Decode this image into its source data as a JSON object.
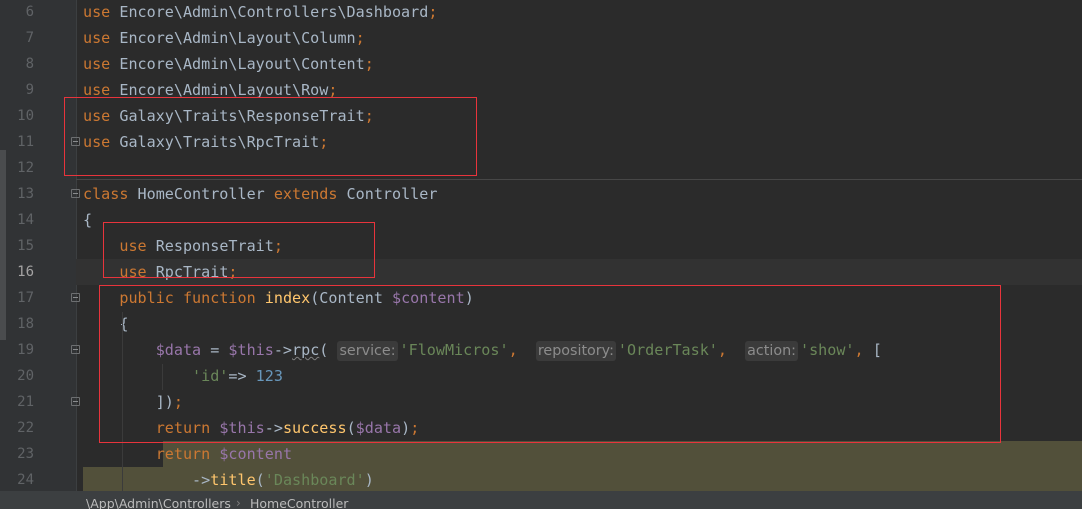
{
  "editor": {
    "lines": [
      {
        "n": "6",
        "tokens": [
          [
            "kw",
            "use"
          ],
          [
            "p",
            " Encore\\Admin\\Controllers\\Dashboard"
          ],
          [
            "kw",
            ";"
          ]
        ]
      },
      {
        "n": "7",
        "tokens": [
          [
            "kw",
            "use"
          ],
          [
            "p",
            " Encore\\Admin\\Layout\\Column"
          ],
          [
            "kw",
            ";"
          ]
        ]
      },
      {
        "n": "8",
        "tokens": [
          [
            "kw",
            "use"
          ],
          [
            "p",
            " Encore\\Admin\\Layout\\Content"
          ],
          [
            "kw",
            ";"
          ]
        ]
      },
      {
        "n": "9",
        "tokens": [
          [
            "kw",
            "use"
          ],
          [
            "p",
            " Encore\\Admin\\Layout\\Row"
          ],
          [
            "kw",
            ";"
          ]
        ]
      },
      {
        "n": "10",
        "tokens": [
          [
            "kw",
            "use"
          ],
          [
            "p",
            " Galaxy\\Traits\\ResponseTrait"
          ],
          [
            "kw",
            ";"
          ]
        ]
      },
      {
        "n": "11",
        "tokens": [
          [
            "kw",
            "use"
          ],
          [
            "p",
            " Galaxy\\Traits\\RpcTrait"
          ],
          [
            "kw",
            ";"
          ]
        ]
      },
      {
        "n": "12",
        "tokens": []
      },
      {
        "n": "13",
        "tokens": [
          [
            "kw",
            "class"
          ],
          [
            "p",
            " HomeController "
          ],
          [
            "kw",
            "extends"
          ],
          [
            "p",
            " Controller"
          ]
        ]
      },
      {
        "n": "14",
        "tokens": [
          [
            "p",
            "{"
          ]
        ]
      },
      {
        "n": "15",
        "tokens": [
          [
            "p",
            "    "
          ],
          [
            "kw",
            "use"
          ],
          [
            "p",
            " ResponseTrait"
          ],
          [
            "kw",
            ";"
          ]
        ]
      },
      {
        "n": "16",
        "tokens": [
          [
            "p",
            "    "
          ],
          [
            "kw",
            "use"
          ],
          [
            "p",
            " RpcTrait"
          ],
          [
            "kw",
            ";"
          ]
        ]
      },
      {
        "n": "17",
        "tokens": [
          [
            "p",
            "    "
          ],
          [
            "kw",
            "public function"
          ],
          [
            "p",
            " "
          ],
          [
            "fn",
            "index"
          ],
          [
            "p",
            "(Content "
          ],
          [
            "var",
            "$content"
          ],
          [
            "p",
            ")"
          ]
        ]
      },
      {
        "n": "18",
        "tokens": [
          [
            "p",
            "    {"
          ]
        ]
      },
      {
        "n": "19",
        "tokens": [
          [
            "p",
            "        "
          ],
          [
            "var",
            "$data"
          ],
          [
            "p",
            " = "
          ],
          [
            "var",
            "$this"
          ],
          [
            "p",
            "->"
          ],
          [
            "sq",
            "rpc"
          ],
          [
            "p",
            "( "
          ],
          [
            "hint",
            "service:"
          ],
          [
            "str",
            "'FlowMicros'"
          ],
          [
            "kw",
            ","
          ],
          [
            "p",
            "  "
          ],
          [
            "hint",
            "repository:"
          ],
          [
            "str",
            "'OrderTask'"
          ],
          [
            "kw",
            ","
          ],
          [
            "p",
            "  "
          ],
          [
            "hint",
            "action:"
          ],
          [
            "str",
            "'show'"
          ],
          [
            "kw",
            ","
          ],
          [
            "p",
            " ["
          ]
        ]
      },
      {
        "n": "20",
        "tokens": [
          [
            "p",
            "            "
          ],
          [
            "str",
            "'id'"
          ],
          [
            "p",
            "=> "
          ],
          [
            "num",
            "123"
          ]
        ]
      },
      {
        "n": "21",
        "tokens": [
          [
            "p",
            "        ])"
          ],
          [
            "kw",
            ";"
          ]
        ]
      },
      {
        "n": "22",
        "tokens": [
          [
            "p",
            "        "
          ],
          [
            "kw",
            "return"
          ],
          [
            "p",
            " "
          ],
          [
            "var",
            "$this"
          ],
          [
            "p",
            "->"
          ],
          [
            "fn",
            "success"
          ],
          [
            "p",
            "("
          ],
          [
            "var",
            "$data"
          ],
          [
            "p",
            ")"
          ],
          [
            "kw",
            ";"
          ]
        ]
      },
      {
        "n": "23",
        "tokens": [
          [
            "p",
            "        "
          ],
          [
            "kw",
            "return"
          ],
          [
            "p",
            " "
          ],
          [
            "var",
            "$content"
          ]
        ]
      },
      {
        "n": "24",
        "tokens": [
          [
            "p",
            "            ->"
          ],
          [
            "fn",
            "title"
          ],
          [
            "p",
            "("
          ],
          [
            "str",
            "'Dashboard'"
          ],
          [
            "p",
            ")"
          ]
        ]
      }
    ]
  },
  "breadcrumb": {
    "path": "\\App\\Admin\\Controllers",
    "separator": "›",
    "current": "HomeController"
  },
  "colors": {
    "keyword": "#cc7832",
    "string": "#6a8759",
    "variable": "#9876aa",
    "function": "#ffc66d",
    "number": "#6897bb",
    "highlight_box": "#e8343c"
  }
}
